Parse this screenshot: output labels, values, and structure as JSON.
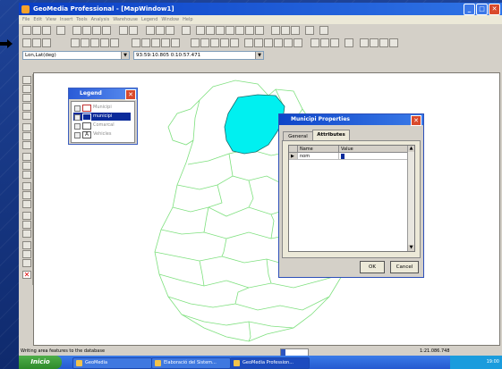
{
  "window": {
    "title": "GeoMedia Professional - [MapWindow1]",
    "min": "_",
    "max": "□",
    "close": "✕"
  },
  "menu": [
    "File",
    "Edit",
    "View",
    "Insert",
    "Tools",
    "Analysis",
    "Warehouse",
    "Legend",
    "Window",
    "Help"
  ],
  "toolbar": {
    "coord_system": "Lon,Lat(deg)",
    "coord_readout": "93:59:10.805 0:10:57.471"
  },
  "legend": {
    "title": "Legend",
    "close": "✕",
    "items": [
      {
        "label": "Municipi",
        "selected": false
      },
      {
        "label": "municipi",
        "selected": true
      },
      {
        "label": "Comarcal",
        "selected": false
      },
      {
        "label": "Vehicles",
        "selected": false
      }
    ]
  },
  "dialog": {
    "title": "Municipi Properties",
    "close": "✕",
    "tabs": [
      "General",
      "Attributes"
    ],
    "columns": [
      "Name",
      "Value"
    ],
    "row": {
      "indicator": "▶",
      "name": "nom",
      "value": ""
    },
    "ok": "OK",
    "cancel": "Cancel"
  },
  "status": {
    "message": "Writing area features to the database",
    "scale": "1:21.086.748"
  },
  "taskbar": {
    "start": "Inicio",
    "tasks": [
      "GeoMedia",
      "Elaboració del Sistem...",
      "GeoMedia Profession..."
    ],
    "time": "19:00"
  },
  "colors": {
    "highlight": "#00f0f0",
    "boundaries": "#7ee07e"
  }
}
